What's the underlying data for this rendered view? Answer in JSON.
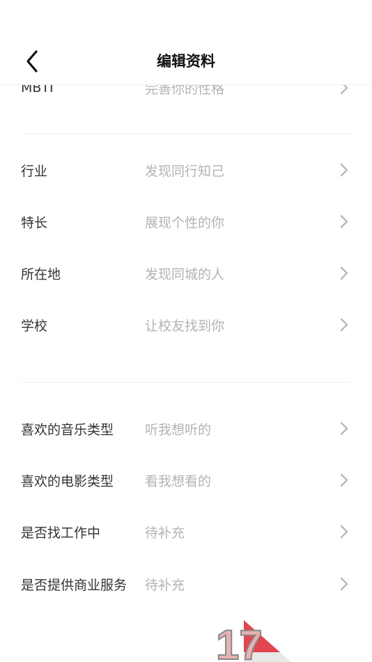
{
  "header": {
    "title": "编辑资料"
  },
  "rows": [
    {
      "label": "MBTI",
      "value": "完善你的性格"
    },
    {
      "label": "行业",
      "value": "发现同行知己"
    },
    {
      "label": "特长",
      "value": "展现个性的你"
    },
    {
      "label": "所在地",
      "value": "发现同城的人"
    },
    {
      "label": "学校",
      "value": "让校友找到你"
    },
    {
      "label": "喜欢的音乐类型",
      "value": "听我想听的"
    },
    {
      "label": "喜欢的电影类型",
      "value": "看我想看的"
    },
    {
      "label": "是否找工作中",
      "value": "待补充"
    },
    {
      "label": "是否提供商业服务",
      "value": "待补充"
    }
  ],
  "sticker": {
    "text": "17"
  },
  "colors": {
    "label": "#333333",
    "value": "#b3b3b3",
    "chevron": "#b8b8b8",
    "divider": "#eeeeee",
    "sticker_red": "#e0343e"
  },
  "icons": [
    "back-arrow-icon",
    "chevron-right-icon"
  ]
}
